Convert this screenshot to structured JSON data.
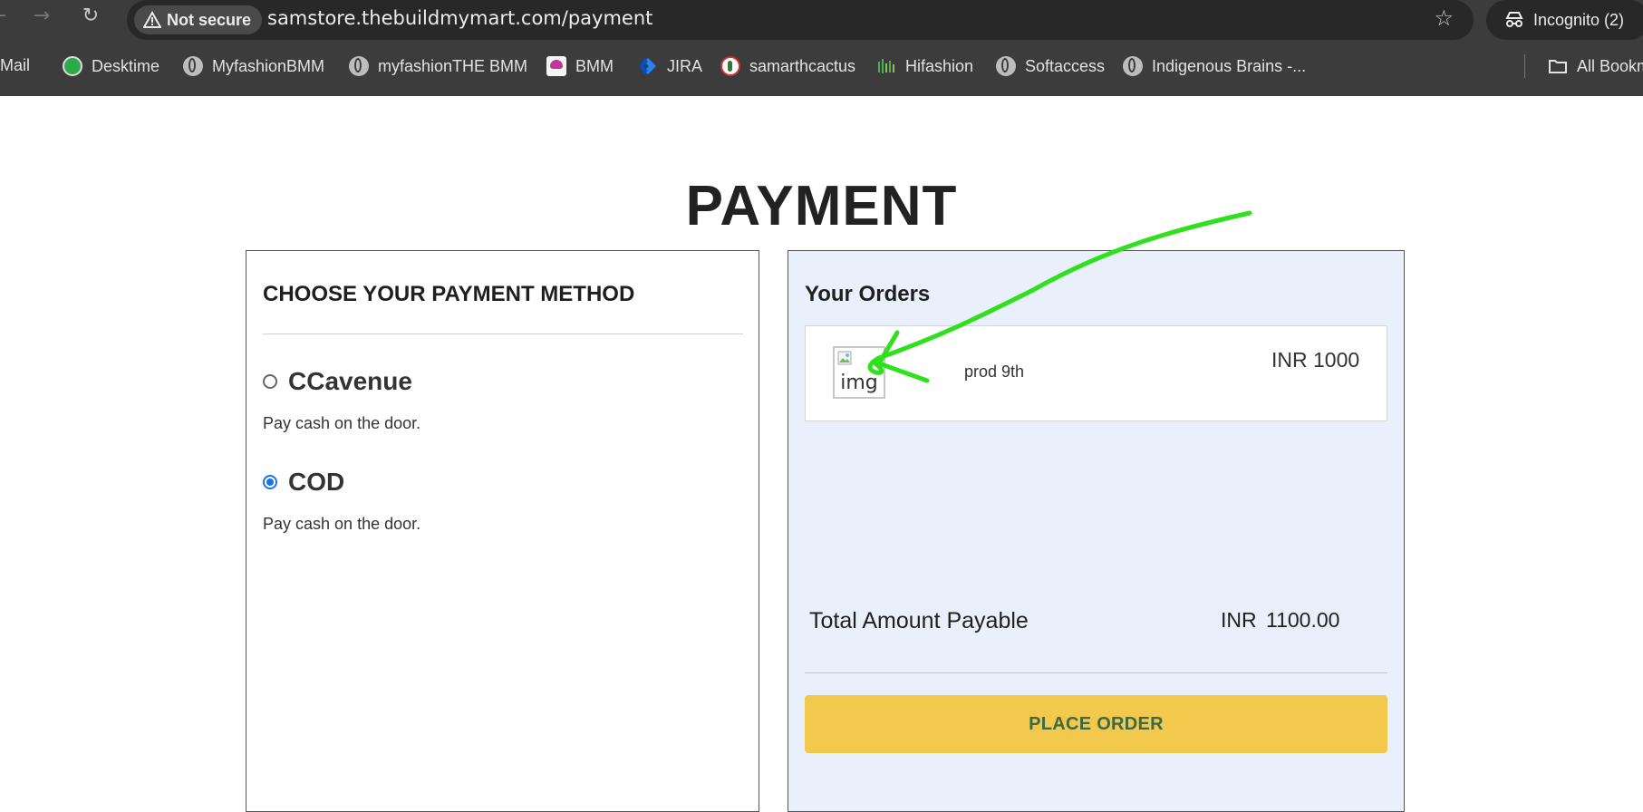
{
  "browser": {
    "security_label": "Not secure",
    "url": "samstore.thebuildmymart.com/payment",
    "incognito_label": "Incognito (2)",
    "bookmarks": [
      {
        "label": "Mail",
        "icon": "mail-icon"
      },
      {
        "label": "Desktime",
        "icon": "desktime-icon"
      },
      {
        "label": "MyfashionBMM",
        "icon": "globe-icon"
      },
      {
        "label": "myfashionTHE BMM",
        "icon": "globe-icon"
      },
      {
        "label": "BMM",
        "icon": "bmm-icon"
      },
      {
        "label": "JIRA",
        "icon": "jira-icon"
      },
      {
        "label": "samarthcactus",
        "icon": "cactus-icon"
      },
      {
        "label": "Hifashion",
        "icon": "hifashion-icon"
      },
      {
        "label": "Softaccess",
        "icon": "globe-icon"
      },
      {
        "label": "Indigenous Brains -...",
        "icon": "globe-icon"
      }
    ],
    "all_bookmarks_label": "All Bookm"
  },
  "page": {
    "title": "PAYMENT"
  },
  "payment_methods": {
    "heading": "CHOOSE YOUR PAYMENT METHOD",
    "options": [
      {
        "label": "CCavenue",
        "description": "Pay cash on the door.",
        "selected": false
      },
      {
        "label": "COD",
        "description": "Pay cash on the door.",
        "selected": true
      }
    ]
  },
  "orders": {
    "heading": "Your Orders",
    "items": [
      {
        "image_alt": "img",
        "name": "prod 9th",
        "price": "INR 1000"
      }
    ],
    "total_label": "Total Amount Payable",
    "total_currency": "INR",
    "total_value": "1100.00",
    "place_order_label": "PLACE ORDER"
  },
  "colors": {
    "chrome_bg": "#3c3c3c",
    "orders_panel_bg": "#e9f0fb",
    "place_order_bg": "#f2c94c",
    "place_order_text": "#3a6a4a",
    "radio_selected": "#1a73e8",
    "annotation_arrow": "#2fe01c"
  }
}
